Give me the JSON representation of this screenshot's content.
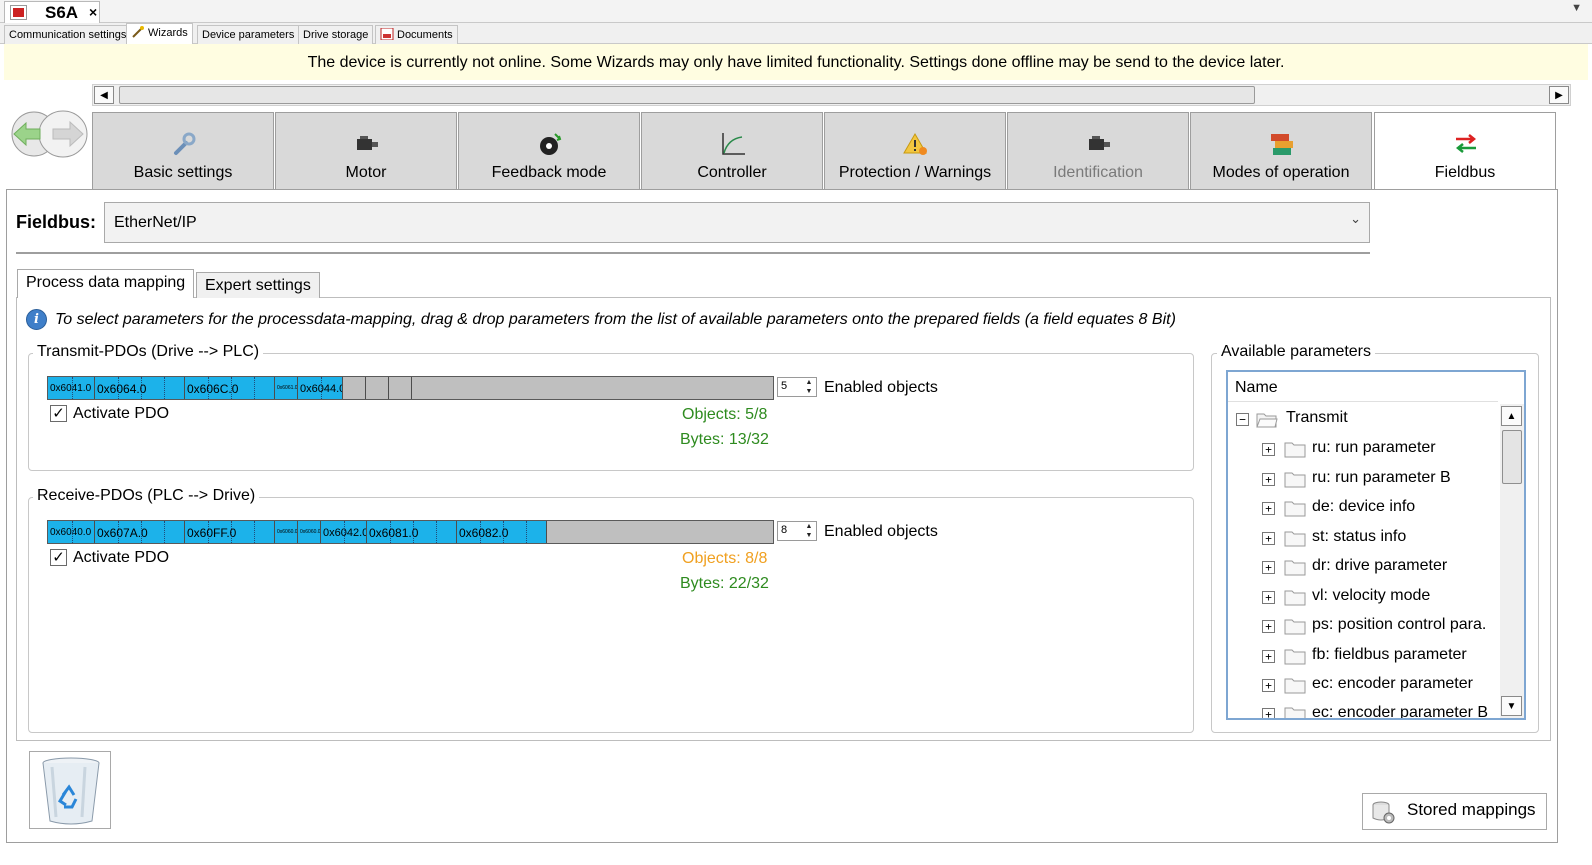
{
  "document_tab": {
    "title": "S6A",
    "close": "×"
  },
  "nav_tabs": [
    {
      "label": "Communication settings"
    },
    {
      "label": "Wizards"
    },
    {
      "label": "Device parameters"
    },
    {
      "label": "Drive storage"
    },
    {
      "label": "Documents"
    }
  ],
  "banner": {
    "text": "The device is currently not online. Some Wizards may only have limited functionality. Settings done offline may be send to the device later."
  },
  "wizard_tabs": [
    {
      "label": "Basic settings",
      "icon": "wrench-icon"
    },
    {
      "label": "Motor",
      "icon": "motor-icon"
    },
    {
      "label": "Feedback mode",
      "icon": "encoder-icon"
    },
    {
      "label": "Controller",
      "icon": "curve-icon"
    },
    {
      "label": "Protection / Warnings",
      "icon": "warning-icon"
    },
    {
      "label": "Identification",
      "icon": "motor-icon"
    },
    {
      "label": "Modes of operation",
      "icon": "modes-icon"
    },
    {
      "label": "Fieldbus",
      "icon": "exchange-arrows-icon"
    }
  ],
  "fieldbus": {
    "label": "Fieldbus:",
    "value": "EtherNet/IP"
  },
  "inner_tabs": [
    {
      "label": "Process data mapping"
    },
    {
      "label": "Expert settings"
    }
  ],
  "info_text": "To select parameters for the processdata-mapping, drag & drop parameters from the list of available parameters onto the prepared fields (a field equates 8 Bit)",
  "transmit": {
    "title": "Transmit-PDOs (Drive --> PLC)",
    "cells": [
      "0x6041.0",
      "0x6064.0",
      "0x606C.0",
      "0x6061.0",
      "0x6044.0"
    ],
    "enabled_value": "5",
    "enabled_label": "Enabled objects",
    "activate_label": "Activate PDO",
    "activate_checked": "✓",
    "objects": "Objects: 5/8",
    "bytes": "Bytes: 13/32",
    "objects_color": "#2e8b1f"
  },
  "receive": {
    "title": "Receive-PDOs (PLC --> Drive)",
    "cells": [
      "0x6040.0",
      "0x607A.0",
      "0x60FF.0",
      "0x6060.0",
      "0x6060.0",
      "0x6042.0",
      "0x6081.0",
      "0x6082.0"
    ],
    "enabled_value": "8",
    "enabled_label": "Enabled objects",
    "activate_label": "Activate PDO",
    "activate_checked": "✓",
    "objects": "Objects: 8/8",
    "bytes": "Bytes: 22/32",
    "objects_color": "#f0a020"
  },
  "available": {
    "title": "Available parameters",
    "column": "Name",
    "root": {
      "label": "Transmit",
      "expander": "−"
    },
    "items": [
      {
        "label": "ru: run parameter",
        "expander": "+"
      },
      {
        "label": "ru: run parameter B",
        "expander": "+"
      },
      {
        "label": "de: device info",
        "expander": "+"
      },
      {
        "label": "st: status info",
        "expander": "+"
      },
      {
        "label": "dr: drive parameter",
        "expander": "+"
      },
      {
        "label": "vl: velocity mode",
        "expander": "+"
      },
      {
        "label": "ps: position control para.",
        "expander": "+"
      },
      {
        "label": "fb: fieldbus parameter",
        "expander": "+"
      },
      {
        "label": "ec: encoder parameter",
        "expander": "+"
      },
      {
        "label": "ec: encoder parameter B",
        "expander": "+"
      }
    ]
  },
  "stored_mappings": {
    "label": "Stored mappings"
  },
  "colors": {
    "pdo_cell": "#1cb2ea",
    "banner": "#fffde1",
    "ok": "#2e8b1f",
    "warn": "#f0a020"
  }
}
